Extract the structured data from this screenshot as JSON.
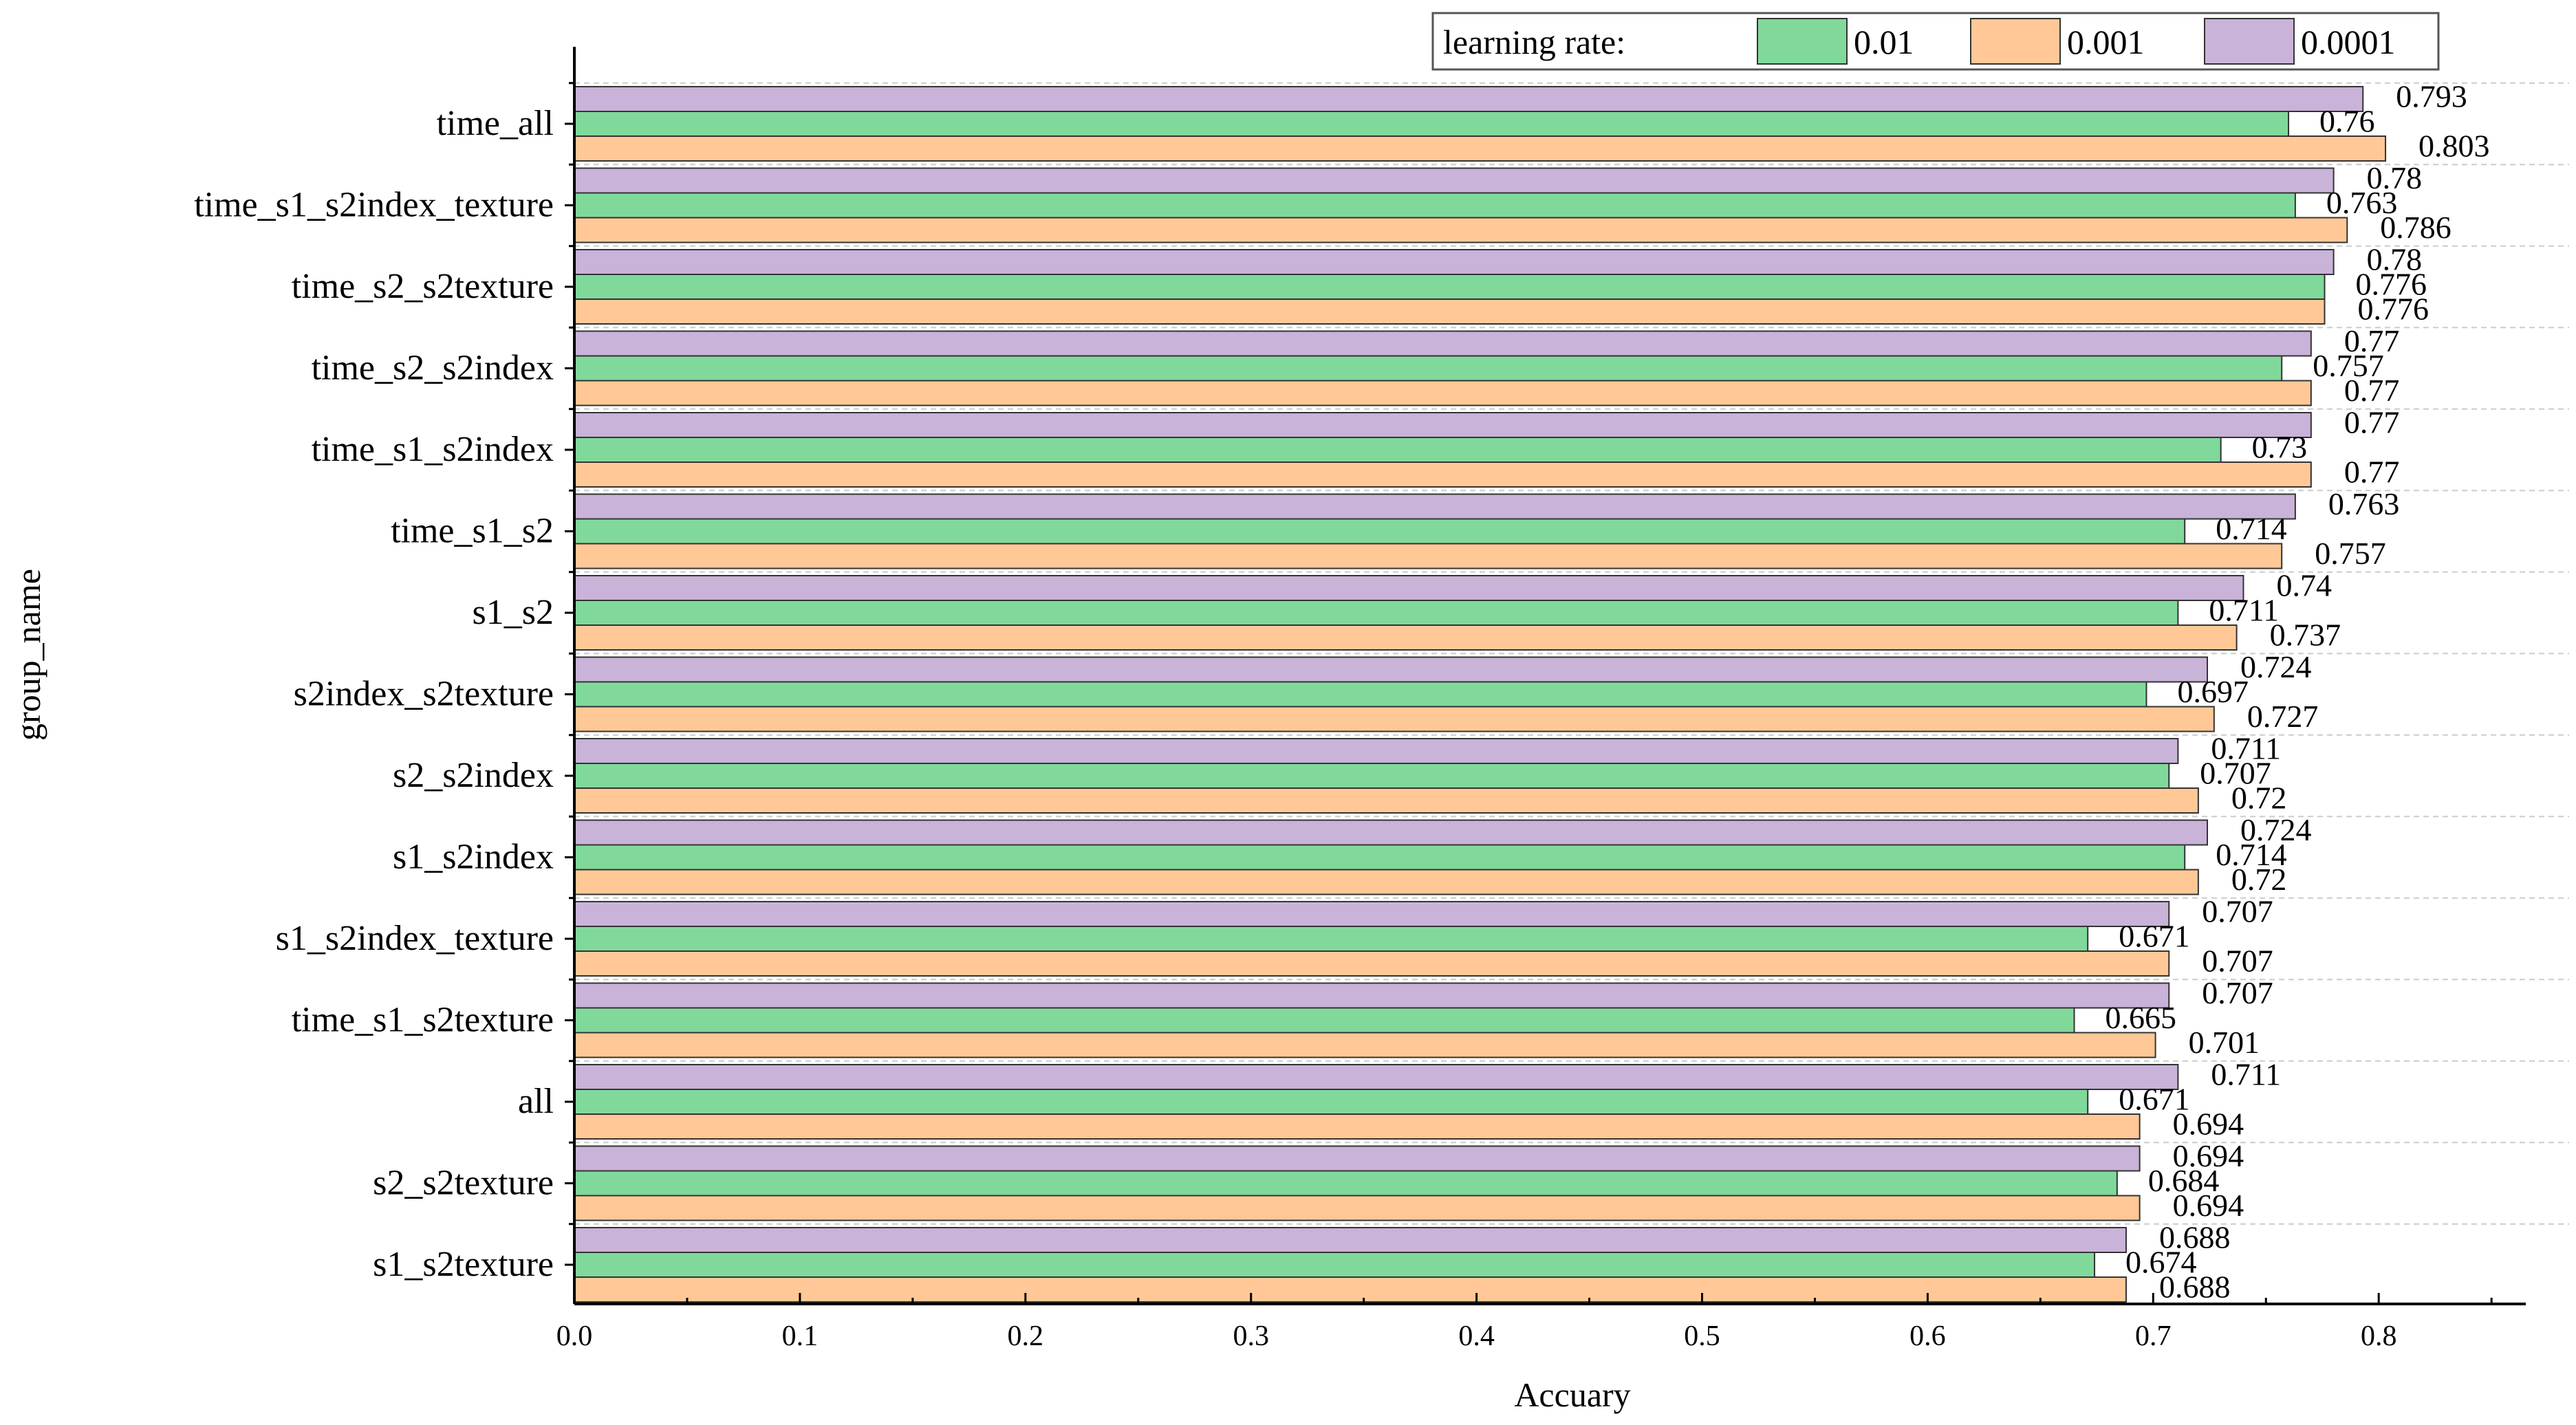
{
  "chart_data": {
    "type": "bar",
    "orientation": "horizontal",
    "xlabel": "Accuary",
    "ylabel": "group_name",
    "xlim": [
      0,
      0.88
    ],
    "xticks": [
      "0.0",
      "0.1",
      "0.2",
      "0.3",
      "0.4",
      "0.5",
      "0.6",
      "0.7",
      "0.8"
    ],
    "grid": "horizontal dashed",
    "legend": {
      "title": "learning rate:",
      "placement": "top-right"
    },
    "categories": [
      "time_all",
      "time_s1_s2index_texture",
      "time_s2_s2texture",
      "time_s2_s2index",
      "time_s1_s2index",
      "time_s1_s2",
      "s1_s2",
      "s2index_s2texture",
      "s2_s2index",
      "s1_s2index",
      "s1_s2index_texture",
      "time_s1_s2texture",
      "all",
      "s2_s2texture",
      "s1_s2texture"
    ],
    "series": [
      {
        "name": "0.0001",
        "color": "#c9b3d9",
        "values": [
          0.793,
          0.78,
          0.78,
          0.77,
          0.77,
          0.763,
          0.74,
          0.724,
          0.711,
          0.724,
          0.707,
          0.707,
          0.711,
          0.694,
          0.688
        ]
      },
      {
        "name": "0.01",
        "color": "#80d99b",
        "values": [
          0.76,
          0.763,
          0.776,
          0.757,
          0.73,
          0.714,
          0.711,
          0.697,
          0.707,
          0.714,
          0.671,
          0.665,
          0.671,
          0.684,
          0.674
        ]
      },
      {
        "name": "0.001",
        "color": "#ffc896",
        "values": [
          0.803,
          0.786,
          0.776,
          0.77,
          0.77,
          0.757,
          0.737,
          0.727,
          0.72,
          0.72,
          0.707,
          0.701,
          0.694,
          0.694,
          0.688
        ]
      }
    ],
    "legend_order": [
      "0.01",
      "0.001",
      "0.0001"
    ]
  }
}
